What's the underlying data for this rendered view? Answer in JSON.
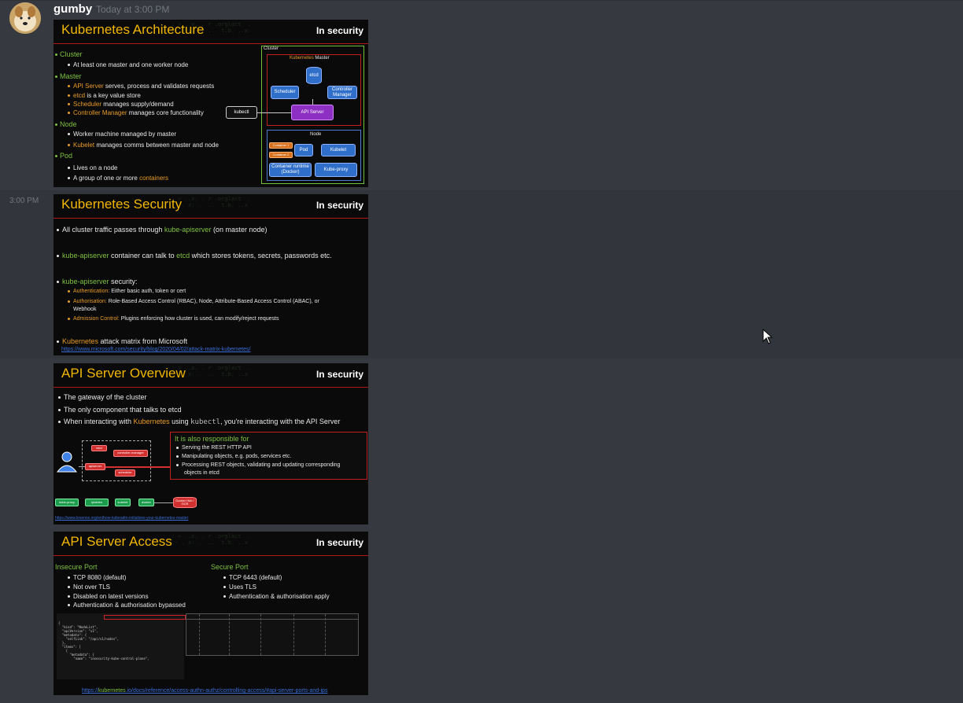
{
  "message": {
    "username": "gumby",
    "timestamp": "Today at 3:00 PM",
    "side_timestamp": "3:00 PM"
  },
  "brand": "In security",
  "slides": [
    {
      "title": "Kubernetes Architecture",
      "bullets": [
        {
          "head": "Cluster",
          "items": [
            "At least one master and one worker node"
          ]
        },
        {
          "head": "Master",
          "items": [
            {
              "hl": "API Server",
              "rest": " serves, process and validates requests"
            },
            {
              "hl": "etcd",
              "rest": " is a key value store"
            },
            {
              "hl": "Scheduler",
              "rest": " manages supply/demand"
            },
            {
              "hl": "Controller Manager",
              "rest": " manages core functionality"
            }
          ]
        },
        {
          "head": "Node",
          "items": [
            "Worker machine managed by master",
            {
              "hl": "Kubelet",
              "rest": " manages comms between master and node"
            }
          ]
        },
        {
          "head": "Pod",
          "items": [
            "Lives on a node",
            {
              "pre": "A group of one or more ",
              "hl": "containers"
            }
          ]
        }
      ],
      "diagram": {
        "cluster": "Cluster",
        "master_hl": "Kubernetes",
        "master_rest": " Master",
        "etcd": "etcd",
        "scheduler": "Scheduler",
        "controller": "Controller Manager",
        "api": "API Server",
        "kubectl": "kubectl",
        "node": "Node",
        "container1": "Container 1",
        "container2": "Container 2",
        "pod": "Pod",
        "kubelet": "Kubelet",
        "runtime": "Container runtime (Docker)",
        "proxy": "Kube-proxy"
      }
    },
    {
      "title": "Kubernetes Security",
      "line1_pre": "All cluster traffic passes through ",
      "line1_hl": "kube-apiserver",
      "line1_post": " (on master node)",
      "line2_hl": "kube-apiserver",
      "line2_mid": " container can talk to ",
      "line2_hl2": "etcd",
      "line2_post": " which stores tokens, secrets, passwords etc.",
      "line3_hl": "kube-apiserver",
      "line3_post": " security:",
      "sub1_hl": "Authentication:",
      "sub1_rest": " Either basic auth, token or cert",
      "sub2_hl": "Authorisation:",
      "sub2_rest": " Role-Based Access Control (RBAC), Node, Attribute-Based Access Control (ABAC), or",
      "sub2_cont": "Webhook",
      "sub3_hl": "Admission Control:",
      "sub3_rest": " Plugins enforcing how cluster is used, can modify/reject requests",
      "line4_hl": "Kubernetes",
      "line4_post": " attack matrix from Microsoft",
      "link": "https://www.microsoft.com/security/blog/2020/04/02/attack-matrix-kubernetes/"
    },
    {
      "title": "API Server Overview",
      "b1": "The gateway of the cluster",
      "b2": "The only component that talks to etcd",
      "b3_pre": "When interacting with ",
      "b3_hl": "Kubernetes",
      "b3_mid": " using ",
      "b3_code": "kubectl",
      "b3_post": ", you're interacting with the API Server",
      "resp_title": "It is also responsible for",
      "resp_items": [
        "Serving the REST HTTP API",
        "Manipulating objects, e.g. pods, services etc.",
        "Processing REST objects, validating and updating corresponding",
        "objects in etcd"
      ],
      "diag": {
        "etcd": "etcd",
        "controller": "controller-manager",
        "apiserver": "apiserver",
        "scheduler": "scheduler",
        "kubeproxy": "kube-proxy",
        "iptables": "iptables",
        "kubelet": "kubelet",
        "docker": "docker",
        "hub": "Docker Hub / GCR"
      },
      "link": "https://www.lesenos.org/en/how-kubeadm-initializes-your-kubernetes-master"
    },
    {
      "title": "API Server Access",
      "insecure_head": "Insecure Port",
      "insecure_items": [
        "TCP 8080 (default)",
        "Not over TLS",
        "Disabled on latest versions",
        "Authentication & authorisation bypassed"
      ],
      "secure_head": "Secure Port",
      "secure_items": [
        "TCP 6443 (default)",
        "Uses TLS",
        "Authentication & authorisation apply"
      ],
      "link_pre": "https://",
      "link_hl": "kubernetes",
      "link_post": ".io/docs/reference/access-authn-authz/controlling-access/#api-server-ports-and-ips"
    }
  ]
}
